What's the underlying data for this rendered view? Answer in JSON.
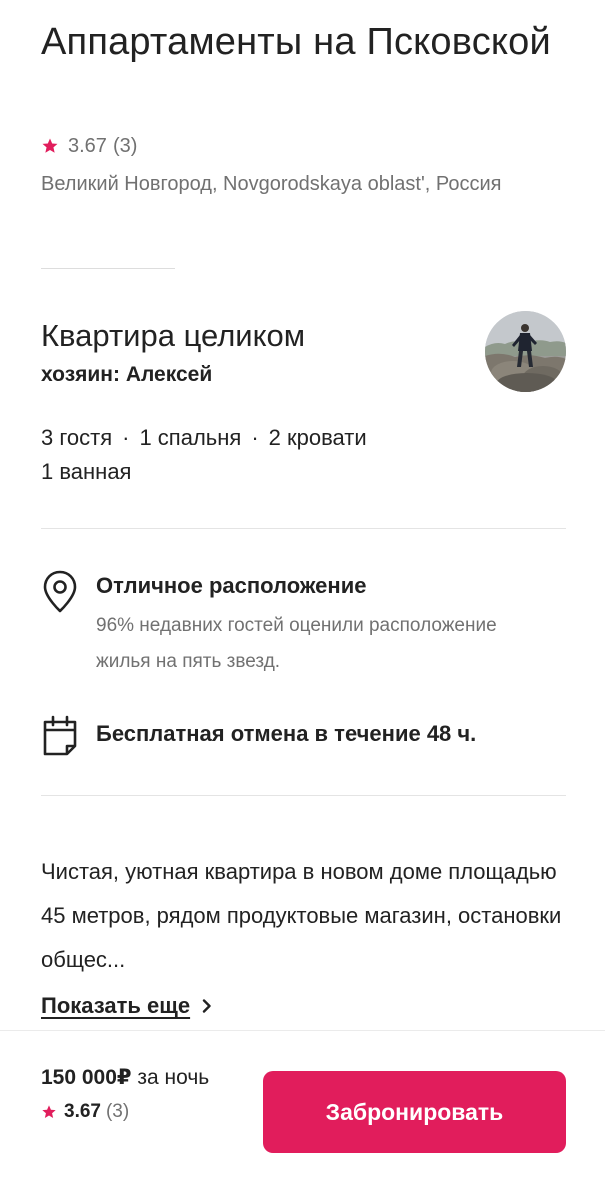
{
  "listing": {
    "title": "Аппартаменты на Псковской",
    "rating": "3.67",
    "reviews": "(3)",
    "location": "Великий Новгород, Novgorodskaya oblast', Россия"
  },
  "host": {
    "title": "Квартира целиком",
    "subtitle": "хозяин: Алексей",
    "avatar_icon": "host-avatar"
  },
  "facts": {
    "guests": "3 гостя",
    "bedrooms": "1 спальня",
    "beds": "2 кровати",
    "baths": "1 ванная",
    "separator": "·"
  },
  "features": [
    {
      "icon": "location-pin-icon",
      "title": "Отличное расположение",
      "description": "96% недавних гостей оценили расположение жилья на пять звезд."
    },
    {
      "icon": "calendar-icon",
      "title": "Бесплатная отмена в течение 48 ч."
    }
  ],
  "description": {
    "text": "Чистая, уютная квартира в новом доме площадью 45 метров, рядом продуктовые магазин, остановки общес...",
    "show_more": "Показать еще"
  },
  "footer": {
    "price": "150 000₽",
    "price_unit": "за ночь",
    "rating": "3.67",
    "reviews": "(3)",
    "book_label": "Забронировать"
  },
  "colors": {
    "accent": "#e11d5c",
    "star": "#e11d5c",
    "text": "#222222",
    "muted": "#717171"
  }
}
